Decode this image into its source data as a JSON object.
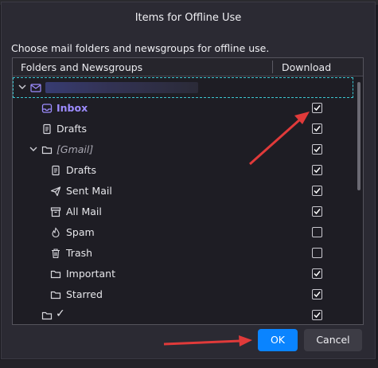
{
  "dialog": {
    "title": "Items for Offline Use",
    "description": "Choose mail folders and newsgroups for offline use."
  },
  "tree": {
    "column_folders": "Folders and Newsgroups",
    "column_download": "Download",
    "rows": [
      {
        "label": "",
        "icon": "mail-account-icon",
        "checked": null
      },
      {
        "label": "Inbox",
        "icon": "inbox-icon",
        "checked": true
      },
      {
        "label": "Drafts",
        "icon": "drafts-icon",
        "checked": true
      },
      {
        "label": "[Gmail]",
        "icon": "folder-icon",
        "checked": true
      },
      {
        "label": "Drafts",
        "icon": "drafts-icon",
        "checked": true
      },
      {
        "label": "Sent Mail",
        "icon": "sent-icon",
        "checked": true
      },
      {
        "label": "All Mail",
        "icon": "archive-icon",
        "checked": true
      },
      {
        "label": "Spam",
        "icon": "spam-icon",
        "checked": false
      },
      {
        "label": "Trash",
        "icon": "trash-icon",
        "checked": false
      },
      {
        "label": "Important",
        "icon": "folder-icon",
        "checked": true
      },
      {
        "label": "Starred",
        "icon": "folder-icon",
        "checked": true
      },
      {
        "label": "✓",
        "icon": "folder-icon",
        "checked": true
      }
    ]
  },
  "buttons": {
    "ok": "OK",
    "cancel": "Cancel"
  },
  "colors": {
    "accent": "#0a84ff",
    "inbox_highlight": "#9d8cff",
    "annotation_arrow": "#e03a3a",
    "focus_outline": "#3cc5d0"
  }
}
